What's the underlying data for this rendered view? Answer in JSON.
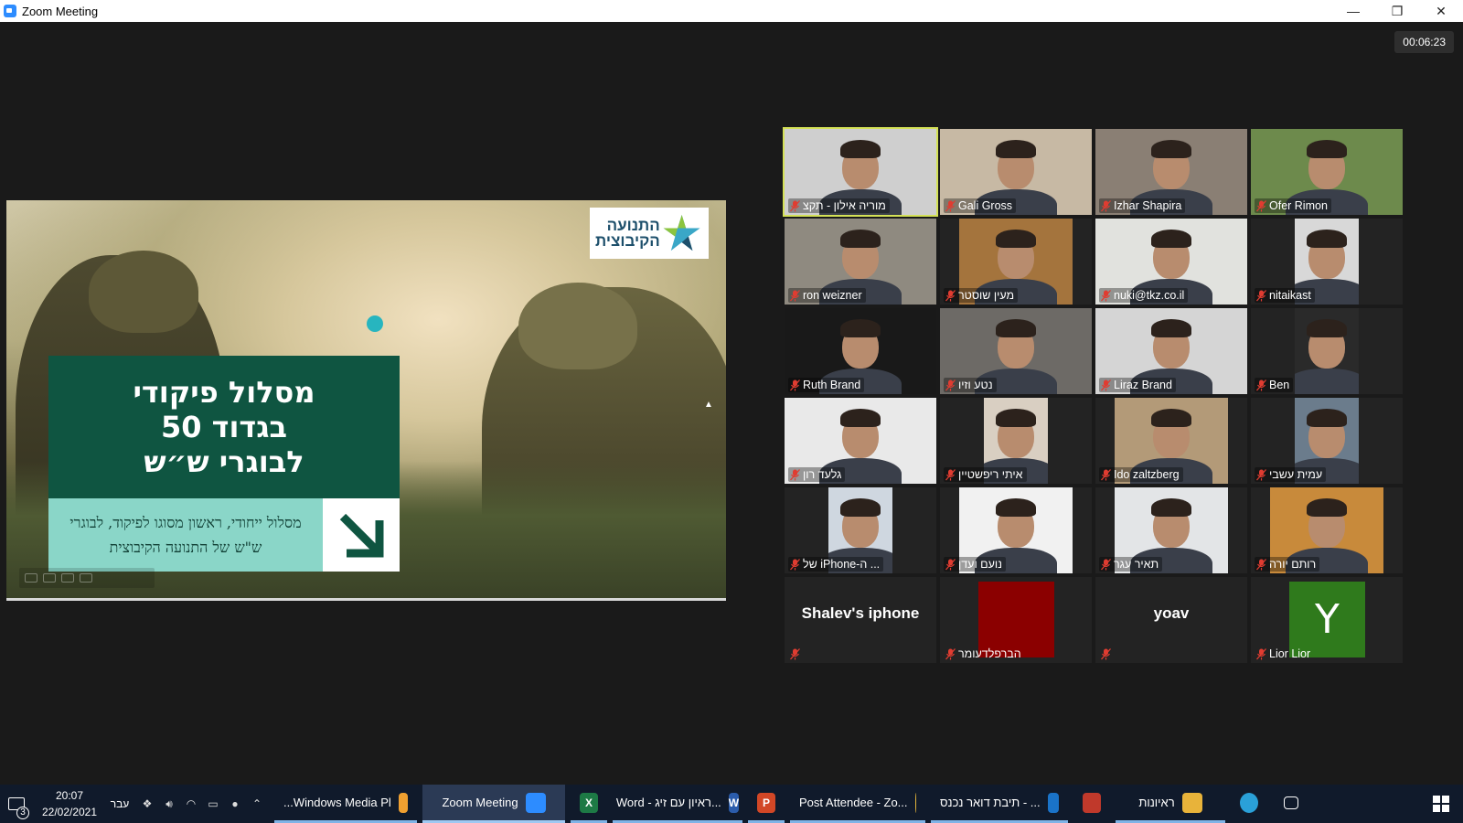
{
  "window": {
    "title": "Zoom Meeting",
    "minimize_glyph": "—",
    "restore_glyph": "❐",
    "close_glyph": "✕"
  },
  "meeting": {
    "timer": "00:06:23"
  },
  "slide": {
    "logo_text_line1": "התנועה",
    "logo_text_line2": "הקיבוצית",
    "headline": "מסלול פיקודי\nבגדוד 50\nלבוגרי ש״ש",
    "subtitle": "מסלול ייחודי, ראשון מסוגו לפיקוד, לבוגרי ש\"ש של התנועה הקיבוצית",
    "accent_teal": "#27b5bf",
    "accent_green": "#0f5541"
  },
  "participants": [
    {
      "name": "מוריה אילון - תקצ",
      "kind": "video",
      "active": true
    },
    {
      "name": "Gali Gross",
      "kind": "video"
    },
    {
      "name": "Izhar Shapira",
      "kind": "video"
    },
    {
      "name": "Ofer Rimon",
      "kind": "video"
    },
    {
      "name": "ron weizner",
      "kind": "video"
    },
    {
      "name": "מעין שוסטר",
      "kind": "video"
    },
    {
      "name": "nuki@tkz.co.il",
      "kind": "video"
    },
    {
      "name": "nitaikast",
      "kind": "video"
    },
    {
      "name": "Ruth Brand",
      "kind": "video"
    },
    {
      "name": "נטע וזיו",
      "kind": "video"
    },
    {
      "name": "Liraz Brand",
      "kind": "video"
    },
    {
      "name": "Ben",
      "kind": "video"
    },
    {
      "name": "גלעד רון",
      "kind": "video"
    },
    {
      "name": "איתי ריפשטיין",
      "kind": "video"
    },
    {
      "name": "Ido zaltzberg",
      "kind": "video"
    },
    {
      "name": "עמית עשבי",
      "kind": "video"
    },
    {
      "name": "של iPhone-ה ...",
      "kind": "video"
    },
    {
      "name": "נועם ועדן",
      "kind": "video"
    },
    {
      "name": "תאיר עגר",
      "kind": "video"
    },
    {
      "name": "רותם יורה",
      "kind": "video"
    },
    {
      "name": "",
      "display_name": "Shalev's iphone",
      "kind": "text"
    },
    {
      "name": "הברפלדעומר",
      "kind": "red"
    },
    {
      "name": "",
      "display_name": "yoav",
      "kind": "text"
    },
    {
      "name": "Lior Lior",
      "kind": "avatar",
      "initial": "Y"
    }
  ],
  "taskbar": {
    "notification_count": "3",
    "time": "20:07",
    "date": "22/02/2021",
    "language": "עבר",
    "apps": [
      {
        "label": "...Windows Media Pl",
        "icon": "media-player-icon",
        "color": "#f0a030",
        "state": "open"
      },
      {
        "label": "Zoom Meeting",
        "icon": "zoom-icon",
        "color": "#2d8cff",
        "state": "active"
      },
      {
        "label": "",
        "icon": "excel-icon",
        "color": "#1d7a45",
        "glyph": "X",
        "state": "open"
      },
      {
        "label": "Word - ראיון עם זיג...",
        "icon": "word-icon",
        "color": "#2b5cab",
        "glyph": "W",
        "state": "open"
      },
      {
        "label": "",
        "icon": "powerpoint-icon",
        "color": "#d24726",
        "glyph": "P",
        "state": "open"
      },
      {
        "label": "Post Attendee - Zo...",
        "icon": "chrome-icon",
        "color": "#e2b33a",
        "state": "open"
      },
      {
        "label": "תיבת דואר נכנס - ...",
        "icon": "outlook-icon",
        "color": "#1a73c8",
        "state": "open"
      },
      {
        "label": "",
        "icon": "shield-app-icon",
        "color": "#c0392b",
        "state": "closed"
      },
      {
        "label": "ראיונות",
        "icon": "folder-icon",
        "color": "#e8b33a",
        "state": "open"
      },
      {
        "label": "",
        "icon": "edge-icon",
        "color": "#2aa0d8",
        "state": "closed"
      },
      {
        "label": "",
        "icon": "task-view-icon",
        "color": "#101a2b",
        "state": "closed"
      }
    ]
  }
}
